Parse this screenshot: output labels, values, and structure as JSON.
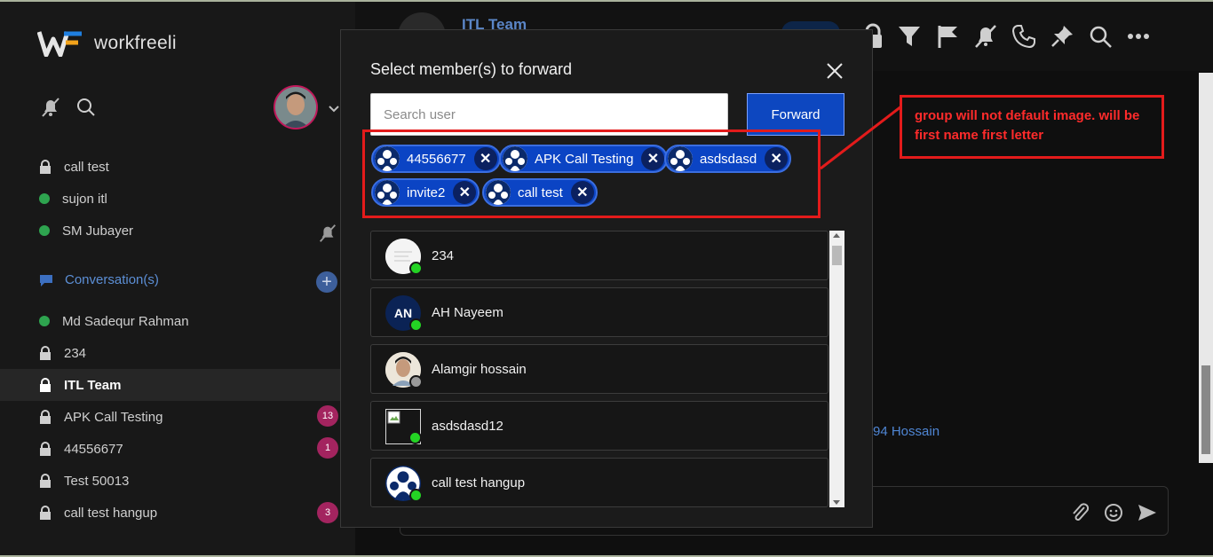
{
  "app": {
    "brand": "workfreeli"
  },
  "sidebar": {
    "items": [
      {
        "label": "call test",
        "type": "lock"
      },
      {
        "label": "sujon itl",
        "type": "online"
      },
      {
        "label": "SM Jubayer",
        "type": "online"
      }
    ],
    "conversations_label": "Conversation(s)",
    "conversations": [
      {
        "label": "Md Sadequr Rahman",
        "type": "online"
      },
      {
        "label": "234",
        "type": "lock"
      },
      {
        "label": "ITL Team",
        "type": "lock",
        "active": true
      },
      {
        "label": "APK Call Testing",
        "type": "lock",
        "badge": "13"
      },
      {
        "label": "44556677",
        "type": "lock",
        "badge": "1"
      },
      {
        "label": "Test 50013",
        "type": "lock"
      },
      {
        "label": "call test hangup",
        "type": "lock",
        "badge": "3"
      }
    ]
  },
  "header": {
    "title": "ITL Team"
  },
  "main": {
    "partial_text": "94 Hossain"
  },
  "modal": {
    "title": "Select member(s) to forward",
    "search_placeholder": "Search user",
    "forward_label": "Forward",
    "chips": [
      {
        "label": "44556677"
      },
      {
        "label": "APK Call Testing"
      },
      {
        "label": "asdsdasd"
      },
      {
        "label": "invite2"
      },
      {
        "label": "call test"
      }
    ],
    "members": [
      {
        "name": "234",
        "avatar": "blank",
        "status": "online"
      },
      {
        "name": "AH Nayeem",
        "avatar": "initials",
        "initials": "AN",
        "status": "online"
      },
      {
        "name": "Alamgir hossain",
        "avatar": "photo",
        "status": "offline"
      },
      {
        "name": "asdsdasd12",
        "avatar": "broken",
        "status": "online"
      },
      {
        "name": "call test hangup",
        "avatar": "group",
        "status": "online"
      }
    ]
  },
  "annotation": {
    "note": "group will not default image. will be first name first letter",
    "color": "#e31b1b"
  },
  "colors": {
    "accent": "#0d47c0",
    "badge": "#a3245f",
    "online": "#24d324",
    "link": "#5b86c7"
  }
}
